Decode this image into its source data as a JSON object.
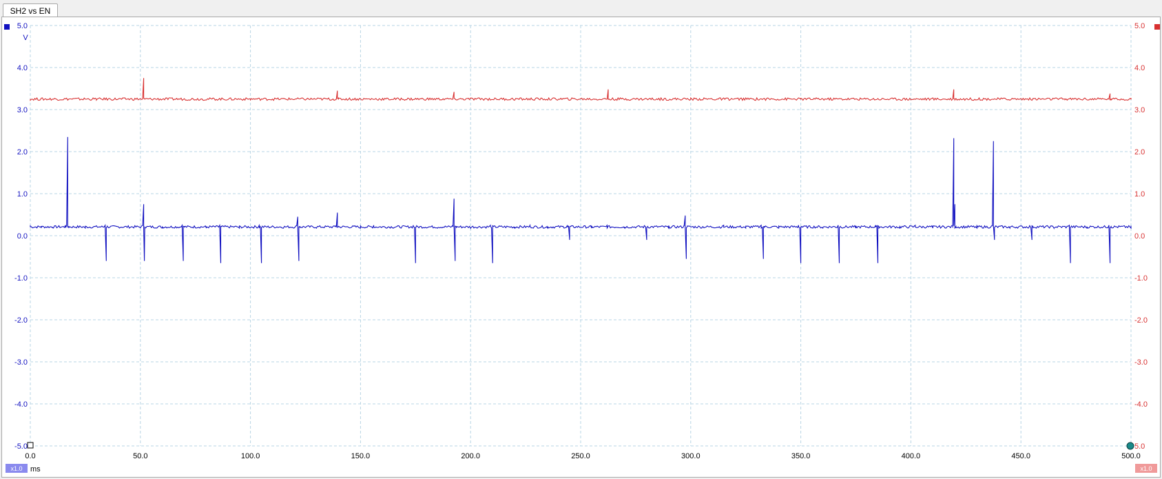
{
  "window": {
    "tab_label": "SH2 vs EN"
  },
  "channels": [
    {
      "name": "",
      "color": "#1010c0",
      "scale_badge": "x1.0",
      "unit": "V"
    },
    {
      "name": "",
      "color": "#d83030",
      "scale_badge": "x1.0",
      "unit": ""
    }
  ],
  "x_axis": {
    "unit": "ms",
    "range": [
      0,
      500
    ],
    "ticks": [
      "0.0",
      "50.0",
      "100.0",
      "150.0",
      "200.0",
      "250.0",
      "300.0",
      "350.0",
      "400.0",
      "450.0",
      "500.0"
    ]
  },
  "y_axis_left": {
    "range": [
      -5,
      5
    ],
    "ticks": [
      "5.0",
      "4.0",
      "3.0",
      "2.0",
      "1.0",
      "0.0",
      "-1.0",
      "-2.0",
      "-3.0",
      "-4.0",
      "-5.0"
    ]
  },
  "y_axis_right": {
    "range": [
      -5,
      5
    ],
    "ticks": [
      "5.0",
      "4.0",
      "3.0",
      "2.0",
      "1.0",
      "0.0",
      "-1.0",
      "-2.0",
      "-3.0",
      "-4.0",
      "5.0"
    ]
  },
  "chart_data": {
    "type": "line",
    "xlabel": "ms",
    "ylabel": "V",
    "xlim": [
      0,
      500
    ],
    "ylim": [
      -5,
      5
    ],
    "grid": true,
    "series": [
      {
        "color": "#1010c0",
        "baseline": 0.21,
        "points": [
          [
            0,
            0.25
          ],
          [
            5,
            0.22
          ],
          [
            10,
            0.2
          ],
          [
            16,
            0.25
          ],
          [
            17,
            2.35
          ],
          [
            17.5,
            0.22
          ],
          [
            25,
            0.18
          ],
          [
            34,
            0.25
          ],
          [
            34.5,
            -0.6
          ],
          [
            35,
            0.22
          ],
          [
            45,
            0.18
          ],
          [
            51,
            0.25
          ],
          [
            51.5,
            0.75
          ],
          [
            51.8,
            -0.6
          ],
          [
            52,
            0.22
          ],
          [
            60,
            0.18
          ],
          [
            69,
            0.25
          ],
          [
            69.5,
            -0.6
          ],
          [
            70,
            0.22
          ],
          [
            80,
            0.18
          ],
          [
            86,
            0.25
          ],
          [
            86.5,
            -0.65
          ],
          [
            87,
            0.22
          ],
          [
            95,
            0.18
          ],
          [
            104,
            0.25
          ],
          [
            105,
            -0.65
          ],
          [
            105.5,
            0.22
          ],
          [
            115,
            0.18
          ],
          [
            121,
            0.25
          ],
          [
            121.5,
            0.45
          ],
          [
            122,
            -0.6
          ],
          [
            122.5,
            0.22
          ],
          [
            130,
            0.18
          ],
          [
            139,
            0.25
          ],
          [
            139.5,
            0.55
          ],
          [
            140,
            0.22
          ],
          [
            150,
            0.18
          ],
          [
            156,
            0.25
          ],
          [
            165,
            0.18
          ],
          [
            174,
            0.25
          ],
          [
            175,
            -0.65
          ],
          [
            175.5,
            0.22
          ],
          [
            185,
            0.18
          ],
          [
            192,
            0.25
          ],
          [
            192.5,
            0.88
          ],
          [
            193,
            -0.6
          ],
          [
            193.5,
            0.22
          ],
          [
            200,
            0.18
          ],
          [
            209,
            0.25
          ],
          [
            210,
            -0.65
          ],
          [
            210.5,
            0.22
          ],
          [
            220,
            0.18
          ],
          [
            227,
            0.25
          ],
          [
            235,
            0.18
          ],
          [
            244,
            0.25
          ],
          [
            245,
            -0.1
          ],
          [
            245.5,
            0.22
          ],
          [
            255,
            0.18
          ],
          [
            262,
            0.25
          ],
          [
            270,
            0.18
          ],
          [
            279,
            0.25
          ],
          [
            280,
            -0.1
          ],
          [
            280.5,
            0.22
          ],
          [
            290,
            0.18
          ],
          [
            297,
            0.25
          ],
          [
            297.5,
            0.48
          ],
          [
            298,
            -0.55
          ],
          [
            298.5,
            0.22
          ],
          [
            305,
            0.18
          ],
          [
            315,
            0.25
          ],
          [
            325,
            0.18
          ],
          [
            332,
            0.25
          ],
          [
            333,
            -0.55
          ],
          [
            333.5,
            0.22
          ],
          [
            340,
            0.18
          ],
          [
            349,
            0.25
          ],
          [
            350,
            -0.65
          ],
          [
            350.5,
            0.22
          ],
          [
            360,
            0.18
          ],
          [
            367,
            0.25
          ],
          [
            367.5,
            -0.65
          ],
          [
            368,
            0.22
          ],
          [
            375,
            0.18
          ],
          [
            384,
            0.25
          ],
          [
            385,
            -0.65
          ],
          [
            385.5,
            0.22
          ],
          [
            395,
            0.18
          ],
          [
            402,
            0.25
          ],
          [
            410,
            0.18
          ],
          [
            419,
            0.25
          ],
          [
            419.5,
            2.32
          ],
          [
            420,
            0.75
          ],
          [
            420.5,
            0.22
          ],
          [
            430,
            0.18
          ],
          [
            437,
            0.25
          ],
          [
            437.5,
            2.25
          ],
          [
            438,
            -0.1
          ],
          [
            438.5,
            0.22
          ],
          [
            445,
            0.18
          ],
          [
            454,
            0.25
          ],
          [
            455,
            -0.1
          ],
          [
            455.5,
            0.22
          ],
          [
            465,
            0.18
          ],
          [
            472,
            0.25
          ],
          [
            472.5,
            -0.65
          ],
          [
            473,
            0.22
          ],
          [
            480,
            0.18
          ],
          [
            490,
            0.25
          ],
          [
            490.5,
            -0.65
          ],
          [
            491,
            0.22
          ],
          [
            500,
            0.18
          ]
        ]
      },
      {
        "color": "#d83030",
        "baseline": 3.25,
        "points": [
          [
            0,
            3.25
          ],
          [
            30,
            3.25
          ],
          [
            51,
            3.25
          ],
          [
            51.5,
            3.75
          ],
          [
            52,
            3.25
          ],
          [
            100,
            3.25
          ],
          [
            139,
            3.25
          ],
          [
            139.5,
            3.45
          ],
          [
            140,
            3.25
          ],
          [
            192,
            3.25
          ],
          [
            192.5,
            3.42
          ],
          [
            193,
            3.25
          ],
          [
            262,
            3.25
          ],
          [
            262.5,
            3.48
          ],
          [
            263,
            3.25
          ],
          [
            300,
            3.25
          ],
          [
            350,
            3.25
          ],
          [
            419,
            3.25
          ],
          [
            419.5,
            3.48
          ],
          [
            420,
            3.25
          ],
          [
            470,
            3.25
          ],
          [
            490,
            3.25
          ],
          [
            490.5,
            3.38
          ],
          [
            491,
            3.25
          ],
          [
            500,
            3.25
          ]
        ]
      }
    ]
  }
}
